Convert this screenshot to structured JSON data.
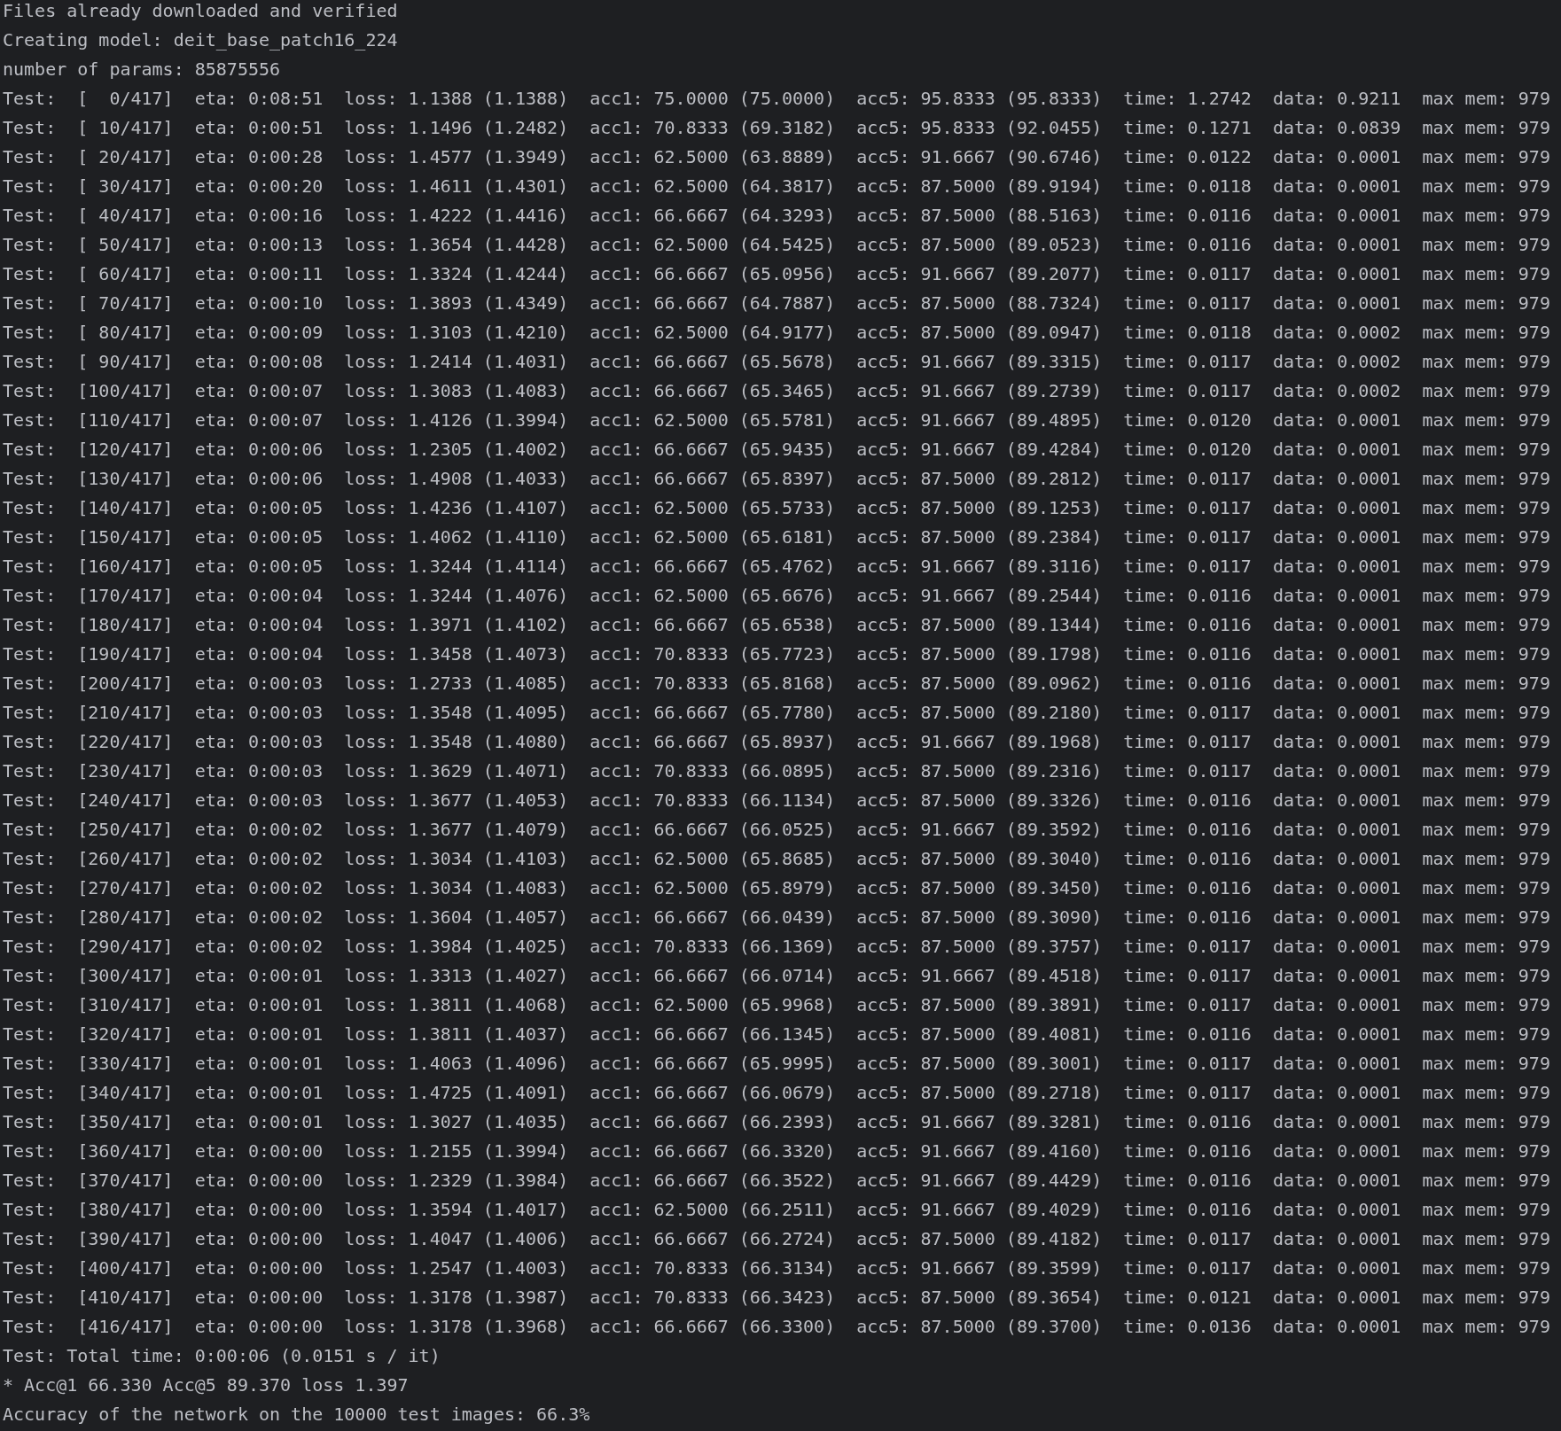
{
  "terminal_lines": [
    "Files already downloaded and verified",
    "Creating model: deit_base_patch16_224",
    "number of params: 85875556",
    "Test:  [  0/417]  eta: 0:08:51  loss: 1.1388 (1.1388)  acc1: 75.0000 (75.0000)  acc5: 95.8333 (95.8333)  time: 1.2742  data: 0.9211  max mem: 979",
    "Test:  [ 10/417]  eta: 0:00:51  loss: 1.1496 (1.2482)  acc1: 70.8333 (69.3182)  acc5: 95.8333 (92.0455)  time: 0.1271  data: 0.0839  max mem: 979",
    "Test:  [ 20/417]  eta: 0:00:28  loss: 1.4577 (1.3949)  acc1: 62.5000 (63.8889)  acc5: 91.6667 (90.6746)  time: 0.0122  data: 0.0001  max mem: 979",
    "Test:  [ 30/417]  eta: 0:00:20  loss: 1.4611 (1.4301)  acc1: 62.5000 (64.3817)  acc5: 87.5000 (89.9194)  time: 0.0118  data: 0.0001  max mem: 979",
    "Test:  [ 40/417]  eta: 0:00:16  loss: 1.4222 (1.4416)  acc1: 66.6667 (64.3293)  acc5: 87.5000 (88.5163)  time: 0.0116  data: 0.0001  max mem: 979",
    "Test:  [ 50/417]  eta: 0:00:13  loss: 1.3654 (1.4428)  acc1: 62.5000 (64.5425)  acc5: 87.5000 (89.0523)  time: 0.0116  data: 0.0001  max mem: 979",
    "Test:  [ 60/417]  eta: 0:00:11  loss: 1.3324 (1.4244)  acc1: 66.6667 (65.0956)  acc5: 91.6667 (89.2077)  time: 0.0117  data: 0.0001  max mem: 979",
    "Test:  [ 70/417]  eta: 0:00:10  loss: 1.3893 (1.4349)  acc1: 66.6667 (64.7887)  acc5: 87.5000 (88.7324)  time: 0.0117  data: 0.0001  max mem: 979",
    "Test:  [ 80/417]  eta: 0:00:09  loss: 1.3103 (1.4210)  acc1: 62.5000 (64.9177)  acc5: 87.5000 (89.0947)  time: 0.0118  data: 0.0002  max mem: 979",
    "Test:  [ 90/417]  eta: 0:00:08  loss: 1.2414 (1.4031)  acc1: 66.6667 (65.5678)  acc5: 91.6667 (89.3315)  time: 0.0117  data: 0.0002  max mem: 979",
    "Test:  [100/417]  eta: 0:00:07  loss: 1.3083 (1.4083)  acc1: 66.6667 (65.3465)  acc5: 91.6667 (89.2739)  time: 0.0117  data: 0.0002  max mem: 979",
    "Test:  [110/417]  eta: 0:00:07  loss: 1.4126 (1.3994)  acc1: 62.5000 (65.5781)  acc5: 91.6667 (89.4895)  time: 0.0120  data: 0.0001  max mem: 979",
    "Test:  [120/417]  eta: 0:00:06  loss: 1.2305 (1.4002)  acc1: 66.6667 (65.9435)  acc5: 91.6667 (89.4284)  time: 0.0120  data: 0.0001  max mem: 979",
    "Test:  [130/417]  eta: 0:00:06  loss: 1.4908 (1.4033)  acc1: 66.6667 (65.8397)  acc5: 87.5000 (89.2812)  time: 0.0117  data: 0.0001  max mem: 979",
    "Test:  [140/417]  eta: 0:00:05  loss: 1.4236 (1.4107)  acc1: 62.5000 (65.5733)  acc5: 87.5000 (89.1253)  time: 0.0117  data: 0.0001  max mem: 979",
    "Test:  [150/417]  eta: 0:00:05  loss: 1.4062 (1.4110)  acc1: 62.5000 (65.6181)  acc5: 87.5000 (89.2384)  time: 0.0117  data: 0.0001  max mem: 979",
    "Test:  [160/417]  eta: 0:00:05  loss: 1.3244 (1.4114)  acc1: 66.6667 (65.4762)  acc5: 91.6667 (89.3116)  time: 0.0117  data: 0.0001  max mem: 979",
    "Test:  [170/417]  eta: 0:00:04  loss: 1.3244 (1.4076)  acc1: 62.5000 (65.6676)  acc5: 91.6667 (89.2544)  time: 0.0116  data: 0.0001  max mem: 979",
    "Test:  [180/417]  eta: 0:00:04  loss: 1.3971 (1.4102)  acc1: 66.6667 (65.6538)  acc5: 87.5000 (89.1344)  time: 0.0116  data: 0.0001  max mem: 979",
    "Test:  [190/417]  eta: 0:00:04  loss: 1.3458 (1.4073)  acc1: 70.8333 (65.7723)  acc5: 87.5000 (89.1798)  time: 0.0116  data: 0.0001  max mem: 979",
    "Test:  [200/417]  eta: 0:00:03  loss: 1.2733 (1.4085)  acc1: 70.8333 (65.8168)  acc5: 87.5000 (89.0962)  time: 0.0116  data: 0.0001  max mem: 979",
    "Test:  [210/417]  eta: 0:00:03  loss: 1.3548 (1.4095)  acc1: 66.6667 (65.7780)  acc5: 87.5000 (89.2180)  time: 0.0117  data: 0.0001  max mem: 979",
    "Test:  [220/417]  eta: 0:00:03  loss: 1.3548 (1.4080)  acc1: 66.6667 (65.8937)  acc5: 91.6667 (89.1968)  time: 0.0117  data: 0.0001  max mem: 979",
    "Test:  [230/417]  eta: 0:00:03  loss: 1.3629 (1.4071)  acc1: 70.8333 (66.0895)  acc5: 87.5000 (89.2316)  time: 0.0117  data: 0.0001  max mem: 979",
    "Test:  [240/417]  eta: 0:00:03  loss: 1.3677 (1.4053)  acc1: 70.8333 (66.1134)  acc5: 87.5000 (89.3326)  time: 0.0116  data: 0.0001  max mem: 979",
    "Test:  [250/417]  eta: 0:00:02  loss: 1.3677 (1.4079)  acc1: 66.6667 (66.0525)  acc5: 91.6667 (89.3592)  time: 0.0116  data: 0.0001  max mem: 979",
    "Test:  [260/417]  eta: 0:00:02  loss: 1.3034 (1.4103)  acc1: 62.5000 (65.8685)  acc5: 87.5000 (89.3040)  time: 0.0116  data: 0.0001  max mem: 979",
    "Test:  [270/417]  eta: 0:00:02  loss: 1.3034 (1.4083)  acc1: 62.5000 (65.8979)  acc5: 87.5000 (89.3450)  time: 0.0116  data: 0.0001  max mem: 979",
    "Test:  [280/417]  eta: 0:00:02  loss: 1.3604 (1.4057)  acc1: 66.6667 (66.0439)  acc5: 87.5000 (89.3090)  time: 0.0116  data: 0.0001  max mem: 979",
    "Test:  [290/417]  eta: 0:00:02  loss: 1.3984 (1.4025)  acc1: 70.8333 (66.1369)  acc5: 87.5000 (89.3757)  time: 0.0117  data: 0.0001  max mem: 979",
    "Test:  [300/417]  eta: 0:00:01  loss: 1.3313 (1.4027)  acc1: 66.6667 (66.0714)  acc5: 91.6667 (89.4518)  time: 0.0117  data: 0.0001  max mem: 979",
    "Test:  [310/417]  eta: 0:00:01  loss: 1.3811 (1.4068)  acc1: 62.5000 (65.9968)  acc5: 87.5000 (89.3891)  time: 0.0117  data: 0.0001  max mem: 979",
    "Test:  [320/417]  eta: 0:00:01  loss: 1.3811 (1.4037)  acc1: 66.6667 (66.1345)  acc5: 87.5000 (89.4081)  time: 0.0116  data: 0.0001  max mem: 979",
    "Test:  [330/417]  eta: 0:00:01  loss: 1.4063 (1.4096)  acc1: 66.6667 (65.9995)  acc5: 87.5000 (89.3001)  time: 0.0117  data: 0.0001  max mem: 979",
    "Test:  [340/417]  eta: 0:00:01  loss: 1.4725 (1.4091)  acc1: 66.6667 (66.0679)  acc5: 87.5000 (89.2718)  time: 0.0117  data: 0.0001  max mem: 979",
    "Test:  [350/417]  eta: 0:00:01  loss: 1.3027 (1.4035)  acc1: 66.6667 (66.2393)  acc5: 91.6667 (89.3281)  time: 0.0116  data: 0.0001  max mem: 979",
    "Test:  [360/417]  eta: 0:00:00  loss: 1.2155 (1.3994)  acc1: 66.6667 (66.3320)  acc5: 91.6667 (89.4160)  time: 0.0116  data: 0.0001  max mem: 979",
    "Test:  [370/417]  eta: 0:00:00  loss: 1.2329 (1.3984)  acc1: 66.6667 (66.3522)  acc5: 91.6667 (89.4429)  time: 0.0116  data: 0.0001  max mem: 979",
    "Test:  [380/417]  eta: 0:00:00  loss: 1.3594 (1.4017)  acc1: 62.5000 (66.2511)  acc5: 91.6667 (89.4029)  time: 0.0116  data: 0.0001  max mem: 979",
    "Test:  [390/417]  eta: 0:00:00  loss: 1.4047 (1.4006)  acc1: 66.6667 (66.2724)  acc5: 87.5000 (89.4182)  time: 0.0117  data: 0.0001  max mem: 979",
    "Test:  [400/417]  eta: 0:00:00  loss: 1.2547 (1.4003)  acc1: 70.8333 (66.3134)  acc5: 91.6667 (89.3599)  time: 0.0117  data: 0.0001  max mem: 979",
    "Test:  [410/417]  eta: 0:00:00  loss: 1.3178 (1.3987)  acc1: 70.8333 (66.3423)  acc5: 87.5000 (89.3654)  time: 0.0121  data: 0.0001  max mem: 979",
    "Test:  [416/417]  eta: 0:00:00  loss: 1.3178 (1.3968)  acc1: 66.6667 (66.3300)  acc5: 87.5000 (89.3700)  time: 0.0136  data: 0.0001  max mem: 979",
    "Test: Total time: 0:00:06 (0.0151 s / it)",
    "* Acc@1 66.330 Acc@5 89.370 loss 1.397",
    "Accuracy of the network on the 10000 test images: 66.3%"
  ]
}
